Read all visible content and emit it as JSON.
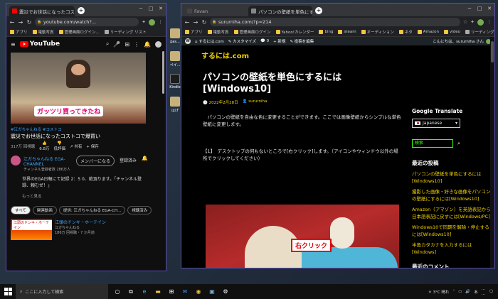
{
  "desktop": {
    "icons": [
      {
        "label": "pas..."
      },
      {
        "label": "ペイ..."
      },
      {
        "label": "Kindle"
      },
      {
        "label": "はげ"
      }
    ]
  },
  "yt_window": {
    "tabs": [
      {
        "title": "震災でお世話になったコストコで爆..."
      }
    ],
    "url": "youtube.com/watch?...",
    "bookmarks": [
      {
        "label": "アプリ"
      },
      {
        "label": "電動写真"
      },
      {
        "label": "管理画面ログイン..."
      },
      {
        "label": "リーディング リスト"
      }
    ],
    "logo_text": "YouTube",
    "video_caption": "ガッツリ買ってきたね",
    "tags": "#江ガちゃんねる #コストコ",
    "title": "震災でお世話になったコストコで爆買い",
    "views": "317万 回視聴",
    "likes": "6.8万",
    "dislike": "低評価",
    "share": "共有",
    "save": "保存",
    "channel_name": "江ガちゃんねる EGA-CHANNEL",
    "channel_subs": "チャンネル登録者数 286万人",
    "member_btn": "メンバーになる",
    "subscribe_btn": "登録済み",
    "description": "世界のEGA日報にて記録 2：5 0、絶頂ります。「チャンネル登録、頼むぜ！」",
    "more": "もっと見る",
    "chips": [
      {
        "label": "すべて"
      },
      {
        "label": "関連動画"
      },
      {
        "label": "提供: 江ガちゃんねる EGA-CH..."
      },
      {
        "label": "視聴済み"
      }
    ],
    "related": {
      "thumb_text": "江頭のドンキ・ホーテイン",
      "title": "江頭のドンキ・ホーテイン",
      "channel": "江ガちゃんねる",
      "meta": "186万 回視聴・7 か月前"
    }
  },
  "blog_window": {
    "tabs": [
      {
        "title": "Favan"
      },
      {
        "title": "パソコンの壁紙を単色にするには[W..."
      }
    ],
    "url": "sururniha.com/?p=214",
    "bookmarks": [
      {
        "label": "アプリ"
      },
      {
        "label": "電動写真"
      },
      {
        "label": "管理画面ログイン"
      },
      {
        "label": "Yahoo!カレンダー"
      },
      {
        "label": "bing"
      },
      {
        "label": "steam"
      },
      {
        "label": "オーディション"
      },
      {
        "label": "ネタ"
      },
      {
        "label": "Amazon"
      },
      {
        "label": "video"
      },
      {
        "label": "リーディング リスト"
      }
    ],
    "admin_bar": {
      "site": "するには.com",
      "customize": "カスタマイズ",
      "comments": "0",
      "new": "新規",
      "edit": "投稿を編集",
      "greeting": "こんにちは、sururniha さん"
    },
    "site_title": "するには.com",
    "post_title": "パソコンの壁紙を単色にするには[Windows10]",
    "date": "2022年2月28日",
    "author": "sururniha",
    "intro": "パソコンの壁紙を自由な色に変更することができます。ここでは画像壁紙からシンプルな単色壁紙に変更します。",
    "step": "【1】　デスクトップの何もないところで[右クリック]します。（アイコンやウィンドウ以外の場所でクリックしてください）",
    "photo_badge": "右クリック",
    "sidebar": {
      "translate_heading": "Google Translate",
      "language": "Japanese",
      "search_placeholder": "検索",
      "recent_heading": "最近の投稿",
      "recent_posts": [
        {
          "title": "パソコンの壁紙を単色にするには[Windows10]"
        },
        {
          "title": "撮影した画像・好きな画像をパソコンの壁紙にするには[Windows10]"
        },
        {
          "title": "Amazon（アマゾン）を英語表記から日本語表記に戻すには[Windows/PC]"
        },
        {
          "title": "Windows10で同期を解除・停止するには[Windows10]"
        },
        {
          "title": "半角カタカナを入力するには[Windows]"
        }
      ],
      "comments_heading": "最近のコメント"
    }
  },
  "taskbar": {
    "search_placeholder": "ここに入力して検索",
    "weather": "3°C 晴れ",
    "time": "...",
    "date": "..."
  },
  "colors": {
    "accent_yellow": "#f4d400",
    "window_border": "#5a4fb0",
    "search_green": "#39ff14"
  }
}
